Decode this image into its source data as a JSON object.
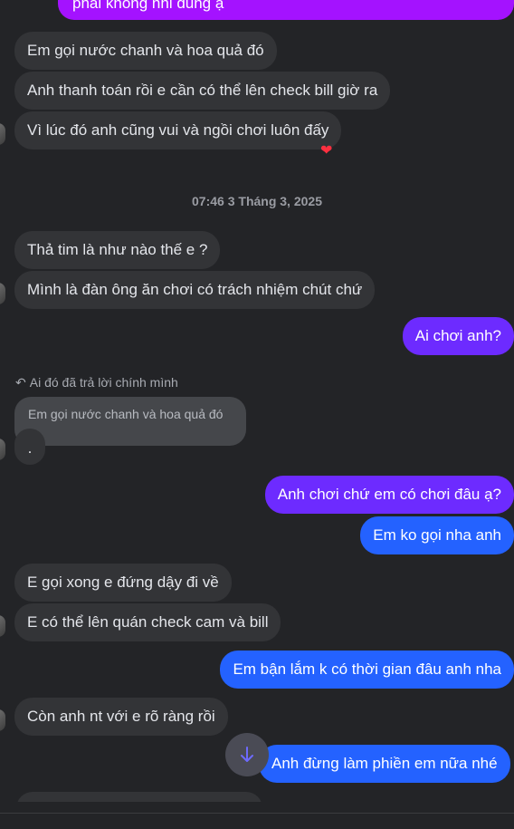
{
  "messages": {
    "top_partial": "phải không nhỉ đúng ạ",
    "m1": "Em gọi nước chanh và hoa quả đó",
    "m2": "Anh thanh toán rồi e cần có thể lên check bill giờ ra",
    "m3": "Vì lúc đó anh cũng vui và ngồi chơi luôn đấy",
    "timestamp": "07:46 3 Tháng 3, 2025",
    "m4": "Thả tim là như nào thế e ?",
    "m5": "Mình là đàn ông ăn chơi có trách nhiệm chút chứ",
    "m6": "Ai chơi anh?",
    "reply_note": "Ai đó đã trả lời chính mình",
    "quoted": "Em gọi nước chanh và hoa quả đó",
    "m7": ".",
    "m8": "Anh chơi chứ em có chơi đâu ạ?",
    "m9": "Em ko gọi nha anh",
    "m10": "E gọi xong e đứng dậy đi về",
    "m11": "E có thể lên quán check cam và bill",
    "m12": "Em bận lắm k có thời gian đâu anh nha",
    "m13": "Còn anh nt với e rõ ràng rồi",
    "m14": "Anh đừng làm phiền em nữa nhé"
  },
  "reaction": "heart-reaction",
  "icons": {
    "scroll": "arrow-down-icon",
    "reply": "reply-arrow-icon"
  },
  "colors": {
    "incoming": "#333437",
    "outgoing_blue": "#2462ff",
    "outgoing_purple": "#6d2bff",
    "accent": "#a412ff"
  }
}
